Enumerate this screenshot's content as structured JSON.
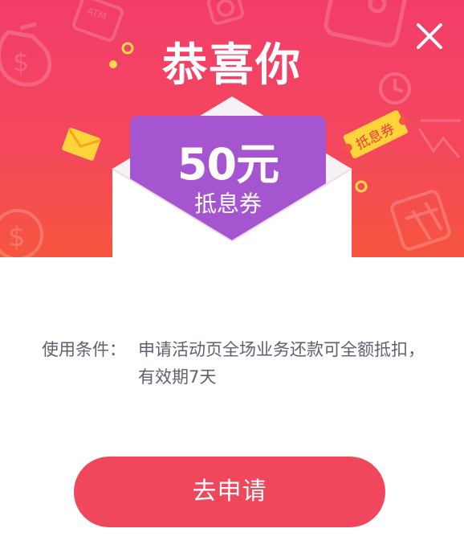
{
  "dialog": {
    "title": "恭喜你",
    "close_icon": "close-icon"
  },
  "coupon": {
    "amount": "50元",
    "type": "抵息券",
    "tag": "抵息券"
  },
  "terms": {
    "label": "使用条件：",
    "text": "申请活动页全场业务还款可全额抵扣，有效期7天"
  },
  "actions": {
    "apply_label": "去申请"
  },
  "colors": {
    "gradient_top": "#f23d6a",
    "gradient_bottom": "#f6553f",
    "envelope_purple": "#a555d0",
    "button": "#f1475c",
    "text": "#5e6270"
  },
  "decor_icons": [
    "money-bag-icon",
    "atm-card-icon",
    "coin-icon",
    "wallet-icon",
    "clock-icon",
    "chart-icon",
    "calculator-icon",
    "envelope-icon",
    "dollar-coin-icon"
  ]
}
